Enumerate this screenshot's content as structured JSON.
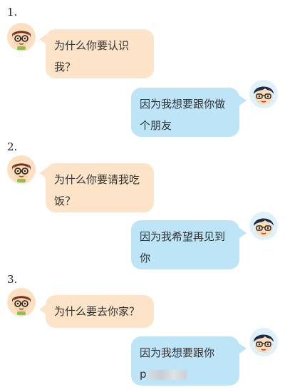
{
  "conversations": [
    {
      "number": "1.",
      "question": "为什么你要认识我？",
      "answer": "因为我想要跟你做个朋友"
    },
    {
      "number": "2.",
      "question": "为什么你要请我吃饭？",
      "answer": "因为我希望再见到你"
    },
    {
      "number": "3.",
      "question": "为什么要去你家？",
      "answer_prefix": "因为我想要跟你",
      "answer_blurred_start": "p"
    }
  ],
  "avatars": {
    "girl": "girl-avatar-icon",
    "boy": "boy-avatar-icon"
  },
  "colors": {
    "girl_bubble": "#fde3c7",
    "boy_bubble": "#bee4f8"
  }
}
